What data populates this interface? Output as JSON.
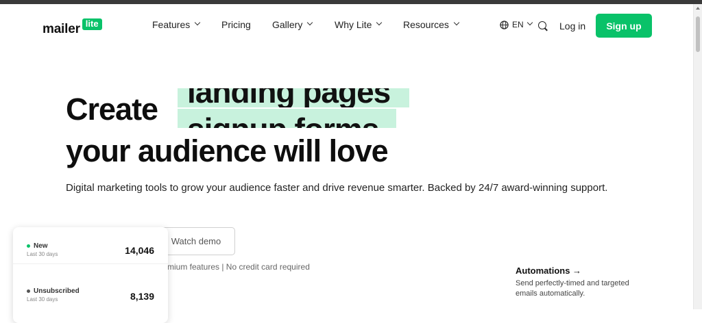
{
  "brand": {
    "name": "mailer",
    "badge": "lite",
    "accent": "#09c269",
    "highlight": "#c8f2dd"
  },
  "nav": {
    "items": [
      {
        "label": "Features",
        "dropdown": true
      },
      {
        "label": "Pricing",
        "dropdown": false
      },
      {
        "label": "Gallery",
        "dropdown": true
      },
      {
        "label": "Why Lite",
        "dropdown": true
      },
      {
        "label": "Resources",
        "dropdown": true
      }
    ],
    "language": "EN",
    "language_icon": "globe-icon",
    "search_icon": "search-icon",
    "login": "Log in",
    "signup": "Sign up"
  },
  "hero": {
    "headline_start": "Create",
    "rotating_words": [
      "landing pages",
      "signup forms"
    ],
    "headline_end": "your audience will love",
    "subtitle": "Digital marketing tools to grow your audience faster and drive revenue smarter. Backed by 24/7 award-winning support.",
    "watch_demo": "Watch demo",
    "note": "mium features | No credit card required"
  },
  "stats": [
    {
      "label": "New",
      "period": "Last 30 days",
      "value": "14,046",
      "color": "#09c269"
    },
    {
      "label": "Unsubscribed",
      "period": "Last 30 days",
      "value": "8,139",
      "color": "#555555"
    }
  ],
  "feature": {
    "title": "Automations →",
    "description": "Send perfectly-timed and targeted emails automatically."
  }
}
